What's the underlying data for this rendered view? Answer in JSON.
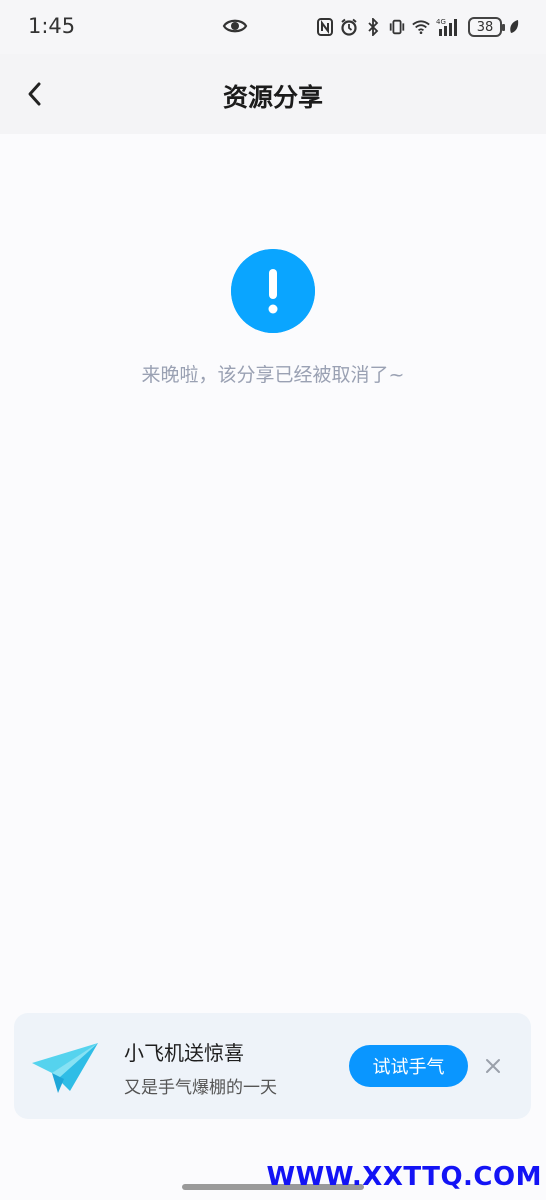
{
  "status_bar": {
    "time": "1:45",
    "battery": "38",
    "network": "4G"
  },
  "header": {
    "title": "资源分享"
  },
  "notice": {
    "icon": "exclamation-icon",
    "message": "来晚啦，该分享已经被取消了~"
  },
  "promo": {
    "title": "小飞机送惊喜",
    "subtitle": "又是手气爆棚的一天",
    "button_label": "试试手气",
    "icon": "paper-plane-icon"
  },
  "watermark": "WWW.XXTTQ.COM",
  "colors": {
    "accent": "#0aa5ff",
    "button": "#0a96ff",
    "watermark": "#1313f5"
  }
}
